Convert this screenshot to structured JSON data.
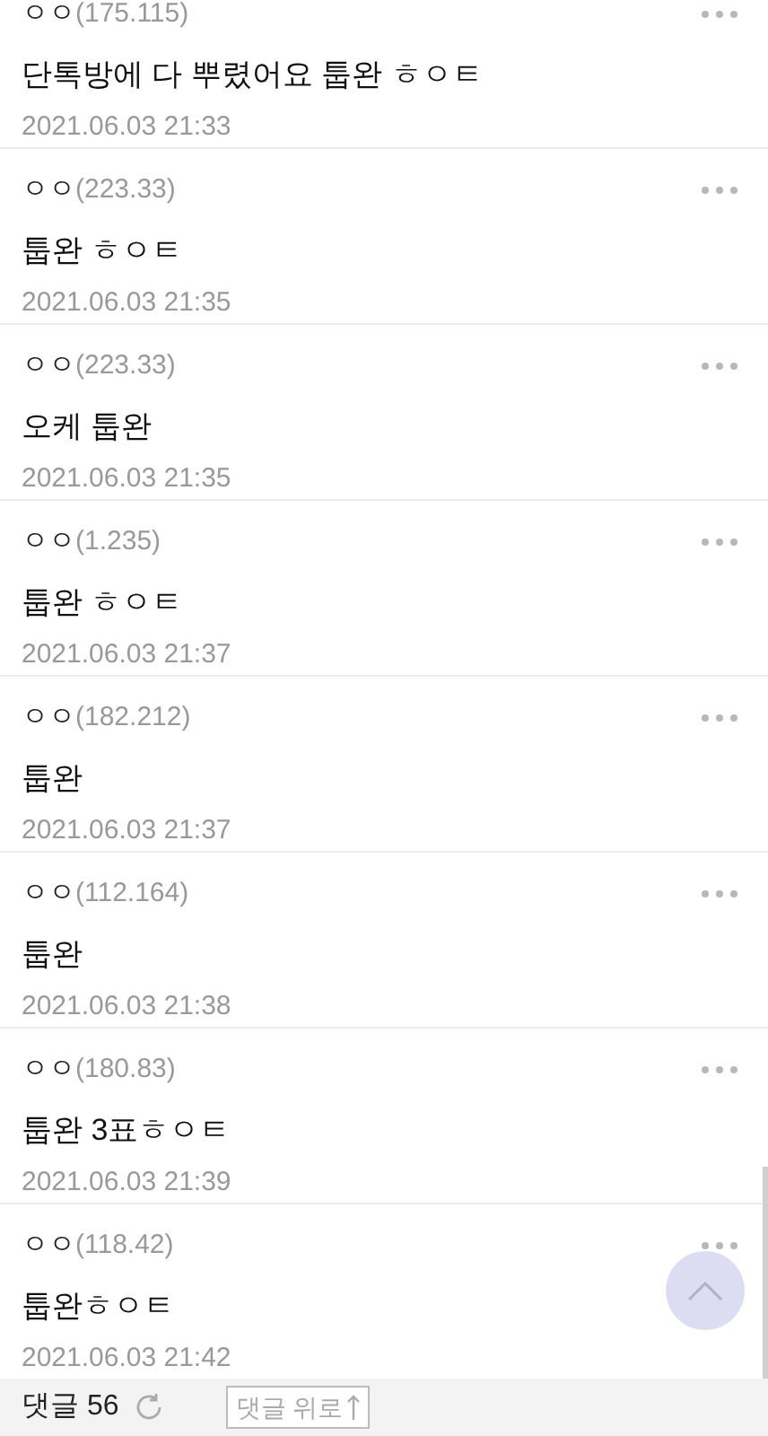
{
  "comments": [
    {
      "author": "ㅇㅇ",
      "ip": "(175.115)",
      "text": "단톡방에 다 뿌렸어요 툽완 ㅎㅇㅌ",
      "date": "2021.06.03 21:33"
    },
    {
      "author": "ㅇㅇ",
      "ip": "(223.33)",
      "text": "툽완 ㅎㅇㅌ",
      "date": "2021.06.03 21:35"
    },
    {
      "author": "ㅇㅇ",
      "ip": "(223.33)",
      "text": "오케 툽완",
      "date": "2021.06.03 21:35"
    },
    {
      "author": "ㅇㅇ",
      "ip": "(1.235)",
      "text": "툽완 ㅎㅇㅌ",
      "date": "2021.06.03 21:37"
    },
    {
      "author": "ㅇㅇ",
      "ip": "(182.212)",
      "text": "툽완",
      "date": "2021.06.03 21:37"
    },
    {
      "author": "ㅇㅇ",
      "ip": "(112.164)",
      "text": "툽완",
      "date": "2021.06.03 21:38"
    },
    {
      "author": "ㅇㅇ",
      "ip": "(180.83)",
      "text": "툽완 3표ㅎㅇㅌ",
      "date": "2021.06.03 21:39"
    },
    {
      "author": "ㅇㅇ",
      "ip": "(118.42)",
      "text": "툽완ㅎㅇㅌ",
      "date": "2021.06.03 21:42"
    }
  ],
  "footer": {
    "comment_label": "댓글 56",
    "to_top_label": "댓글 위로"
  }
}
